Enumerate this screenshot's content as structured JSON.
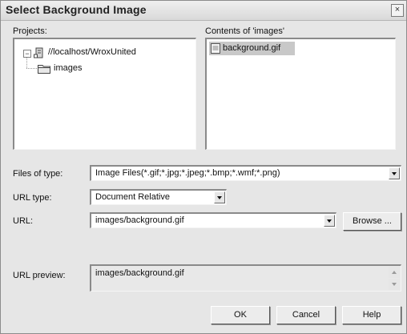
{
  "dialog": {
    "title": "Select Background Image",
    "close_glyph": "×"
  },
  "projects": {
    "label": "Projects:",
    "expander_glyph": "−",
    "tree": [
      {
        "label": "//localhost/WroxUnited",
        "icon": "server-icon"
      },
      {
        "label": "images",
        "icon": "folder-icon"
      }
    ]
  },
  "contents": {
    "label": "Contents of 'images'",
    "files": [
      {
        "name": "background.gif",
        "icon": "file-icon",
        "selected": true
      }
    ]
  },
  "form": {
    "files_of_type": {
      "label": "Files of type:",
      "value": "Image Files(*.gif;*.jpg;*.jpeg;*.bmp;*.wmf;*.png)"
    },
    "url_type": {
      "label": "URL type:",
      "value": "Document Relative"
    },
    "url": {
      "label": "URL:",
      "value": "images/background.gif",
      "browse_label": "Browse ..."
    },
    "url_preview": {
      "label": "URL preview:",
      "value": "images/background.gif"
    }
  },
  "buttons": {
    "ok": "OK",
    "cancel": "Cancel",
    "help": "Help"
  },
  "colors": {
    "dialog_bg": "#e6e6e6",
    "selection": "#c8c8c8"
  }
}
